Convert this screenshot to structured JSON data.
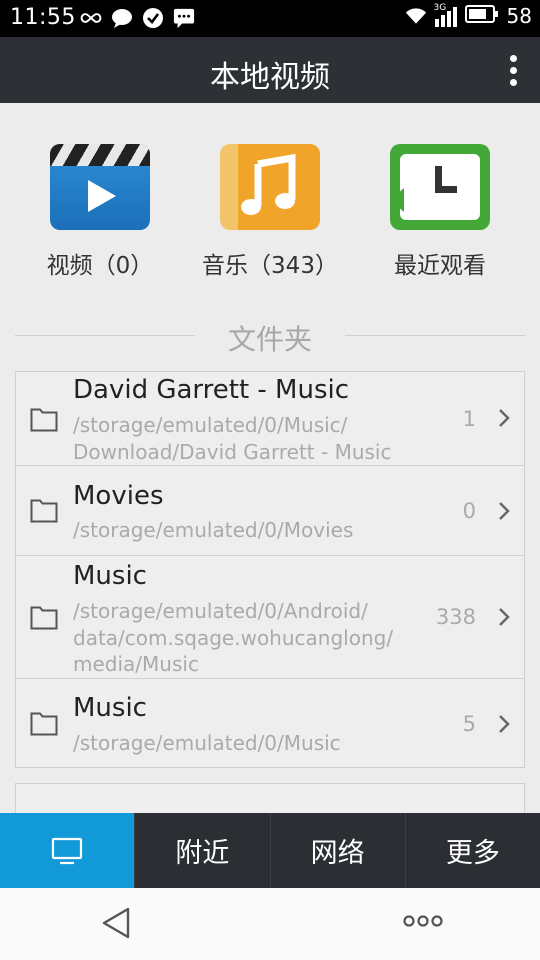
{
  "status_bar": {
    "time": "11:55",
    "icons": [
      "infinity-icon",
      "chat-bubble-icon",
      "check-circle-icon",
      "message-icon",
      "wifi-icon",
      "signal-3g-icon",
      "battery-icon"
    ],
    "network": "3G",
    "battery": "58"
  },
  "header": {
    "title": "本地视频"
  },
  "categories": [
    {
      "label": "视频（0）",
      "icon": "video-clapper-icon",
      "color": "#2d8fd8"
    },
    {
      "label": "音乐（343）",
      "icon": "music-note-icon",
      "color": "#f0a52a"
    },
    {
      "label": "最近观看",
      "icon": "recent-clock-icon",
      "color": "#43a838"
    }
  ],
  "section": {
    "title": "文件夹"
  },
  "folders": [
    {
      "name": "David Garrett - Music",
      "path": "/storage/emulated/0/Music/\nDownload/David Garrett - Music",
      "count": "1"
    },
    {
      "name": "Movies",
      "path": "/storage/emulated/0/Movies",
      "count": "0"
    },
    {
      "name": "Music",
      "path": "/storage/emulated/0/Android/\ndata/com.sqage.wohucanglong/\nmedia/Music",
      "count": "338"
    },
    {
      "name": "Music",
      "path": "/storage/emulated/0/Music",
      "count": "5"
    }
  ],
  "tabs": [
    {
      "label": "",
      "icon": "monitor-icon",
      "active": true
    },
    {
      "label": "附近"
    },
    {
      "label": "网络"
    },
    {
      "label": "更多"
    }
  ],
  "nav_bar": {
    "back_icon": "back-triangle-icon",
    "more_icon": "more-dots-icon"
  },
  "colors": {
    "status_bar": "#000000",
    "title_bar": "#2d3035",
    "tab_bar": "#2b2e33",
    "accent": "#129ad8",
    "background": "#ececec"
  }
}
